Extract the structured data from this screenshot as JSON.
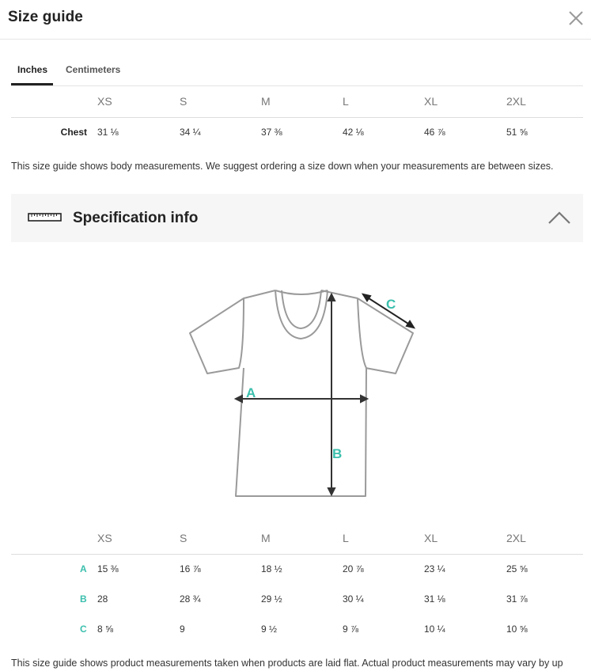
{
  "header": {
    "title": "Size guide",
    "close_icon": "close-icon"
  },
  "tabs": [
    {
      "label": "Inches",
      "active": true
    },
    {
      "label": "Centimeters",
      "active": false
    }
  ],
  "body_table": {
    "sizes": [
      "XS",
      "S",
      "M",
      "L",
      "XL",
      "2XL"
    ],
    "rows": [
      {
        "label": "Chest",
        "values": [
          "31 ⅛",
          "34 ¼",
          "37 ⅜",
          "42 ⅛",
          "46 ⅞",
          "51 ⅝"
        ]
      }
    ]
  },
  "body_note": "This size guide shows body measurements. We suggest ordering a size down when your measurements are between sizes.",
  "spec": {
    "icon": "ruler-icon",
    "title": "Specification info",
    "toggle_icon": "chevron-up-icon",
    "expanded": true
  },
  "diagram": {
    "labels": [
      "A",
      "B",
      "C"
    ],
    "accent_color": "#3bbfad"
  },
  "product_table": {
    "sizes": [
      "XS",
      "S",
      "M",
      "L",
      "XL",
      "2XL"
    ],
    "rows": [
      {
        "label": "A",
        "values": [
          "15 ⅜",
          "16 ⅞",
          "18 ½",
          "20 ⅞",
          "23 ¼",
          "25 ⅝"
        ]
      },
      {
        "label": "B",
        "values": [
          "28",
          "28 ¾",
          "29 ½",
          "30 ¼",
          "31 ⅛",
          "31 ⅞"
        ]
      },
      {
        "label": "C",
        "values": [
          "8 ⅝",
          "9",
          "9 ½",
          "9 ⅞",
          "10 ¼",
          "10 ⅝"
        ]
      }
    ]
  },
  "product_note": "This size guide shows product measurements taken when products are laid flat. Actual product measurements may vary by up"
}
